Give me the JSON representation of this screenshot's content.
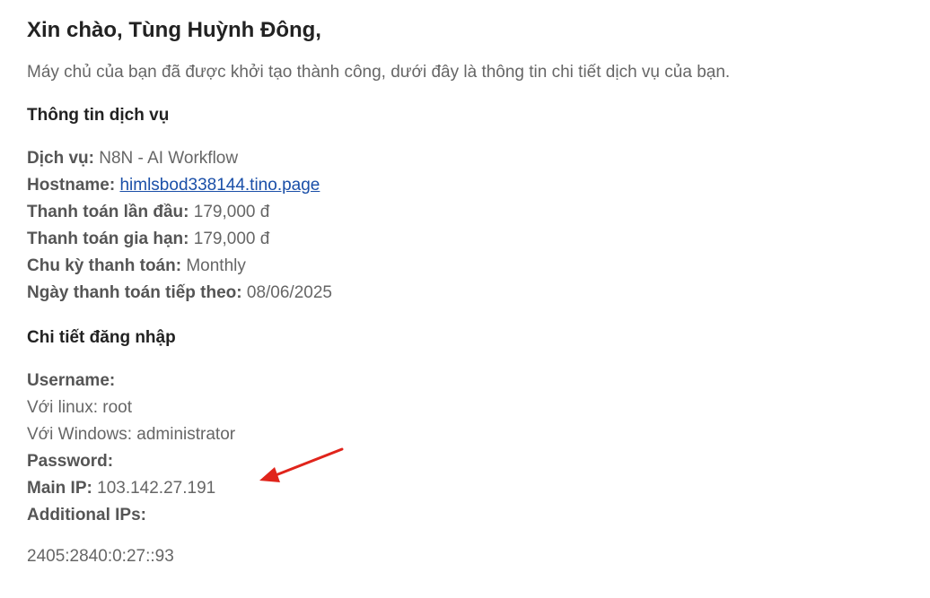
{
  "greeting": "Xin chào, Tùng Huỳnh Đông,",
  "intro": "Máy chủ của bạn đã được khởi tạo thành công, dưới đây là thông tin chi tiết dịch vụ của bạn.",
  "service_section": {
    "title": "Thông tin dịch vụ",
    "service_label": "Dịch vụ:",
    "service_value": "N8N - AI Workflow",
    "hostname_label": "Hostname:",
    "hostname_value": "himlsbod338144.tino.page",
    "first_payment_label": "Thanh toán lần đầu:",
    "first_payment_value": "179,000 đ",
    "renewal_label": "Thanh toán gia hạn:",
    "renewal_value": "179,000 đ",
    "cycle_label": "Chu kỳ thanh toán:",
    "cycle_value": "Monthly",
    "next_due_label": "Ngày thanh toán tiếp theo:",
    "next_due_value": "08/06/2025"
  },
  "login_section": {
    "title": "Chi tiết đăng nhập",
    "username_label": "Username:",
    "linux_line": "Với linux: root",
    "windows_line": "Với Windows: administrator",
    "password_label": "Password:",
    "main_ip_label": "Main IP:",
    "main_ip_value": "103.142.27.191",
    "additional_ips_label": "Additional IPs:",
    "additional_ip_value": "2405:2840:0:27::93"
  },
  "colors": {
    "annotation_arrow": "#e0241b",
    "link": "#1a4fa8",
    "body_text": "#666666",
    "heading_text": "#222222"
  }
}
